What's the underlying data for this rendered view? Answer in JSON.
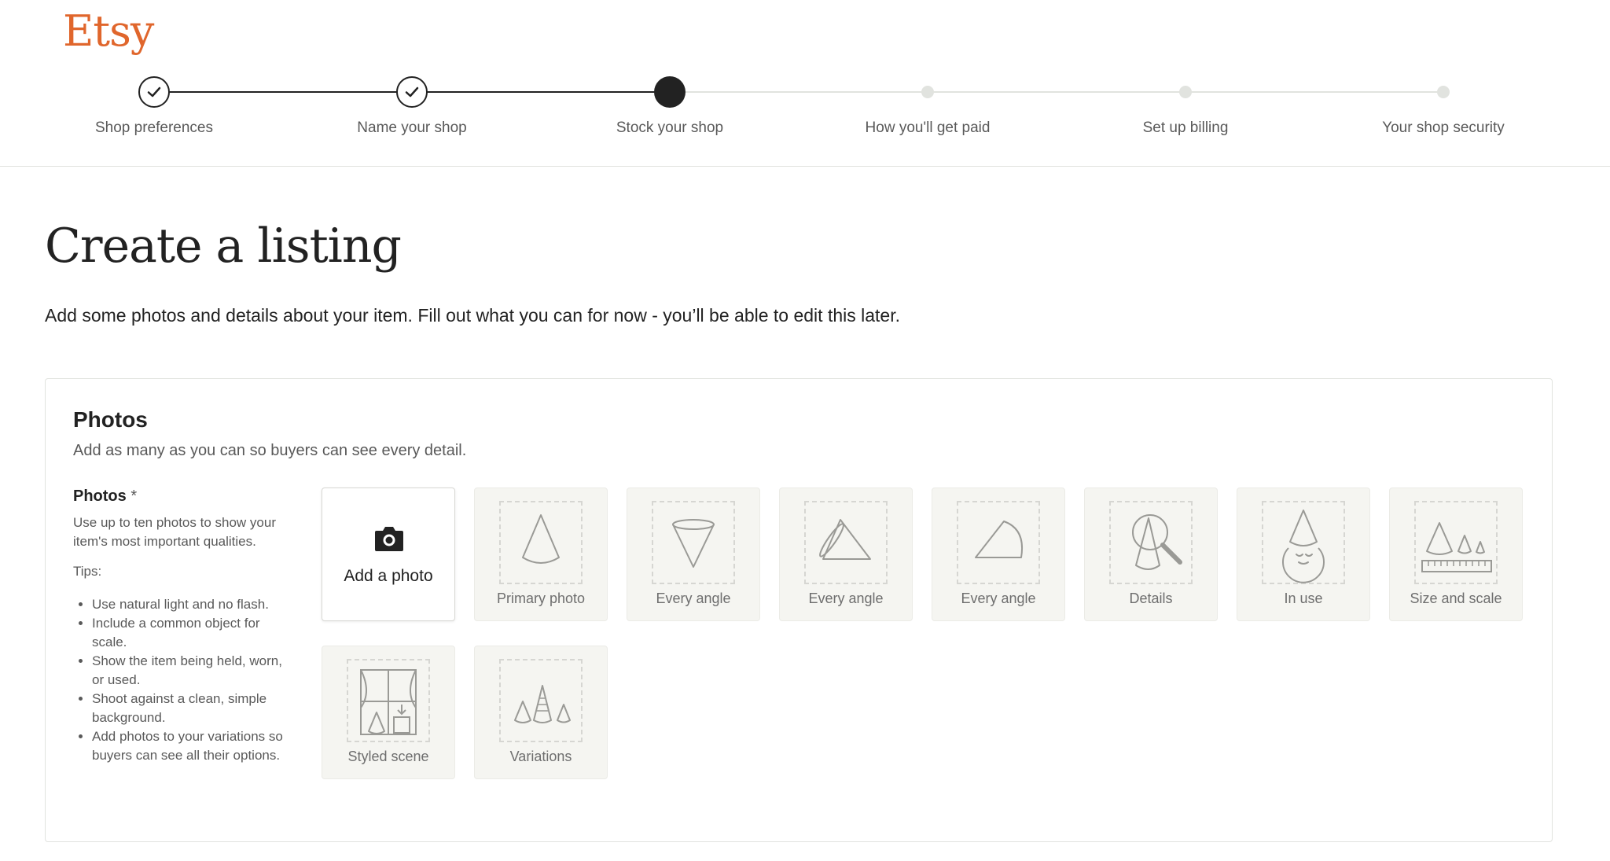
{
  "brand": {
    "logo_text": "Etsy",
    "color": "#e0662c"
  },
  "stepper": {
    "steps": [
      {
        "label": "Shop preferences",
        "state": "done"
      },
      {
        "label": "Name your shop",
        "state": "done"
      },
      {
        "label": "Stock your shop",
        "state": "current"
      },
      {
        "label": "How you'll get paid",
        "state": "future"
      },
      {
        "label": "Set up billing",
        "state": "future"
      },
      {
        "label": "Your shop security",
        "state": "future"
      }
    ]
  },
  "main": {
    "title": "Create a listing",
    "subtitle": "Add some photos and details about your item. Fill out what you can for now - you’ll be able to edit this later."
  },
  "photos_section": {
    "title": "Photos",
    "subtitle": "Add as many as you can so buyers can see every detail.",
    "field_label": "Photos",
    "required_mark": "*",
    "description": "Use up to ten photos to show your item's most important qualities.",
    "tips_label": "Tips:",
    "tips": [
      "Use natural light and no flash.",
      "Include a common object for scale.",
      "Show the item being held, worn, or used.",
      "Shoot against a clean, simple background.",
      "Add photos to your variations so buyers can see all their options."
    ],
    "add_photo_label": "Add a photo",
    "add_photo_icon": "camera-icon",
    "slots": [
      {
        "label": "Primary photo",
        "icon": "cone-icon"
      },
      {
        "label": "Every angle",
        "icon": "cone-inverted-icon"
      },
      {
        "label": "Every angle",
        "icon": "cone-side-icon"
      },
      {
        "label": "Every angle",
        "icon": "cone-tilted-icon"
      },
      {
        "label": "Details",
        "icon": "magnifier-cone-icon"
      },
      {
        "label": "In use",
        "icon": "person-cone-hat-icon"
      },
      {
        "label": "Size and scale",
        "icon": "cones-ruler-icon"
      },
      {
        "label": "Styled scene",
        "icon": "window-scene-icon"
      },
      {
        "label": "Variations",
        "icon": "three-cones-icon"
      }
    ]
  }
}
